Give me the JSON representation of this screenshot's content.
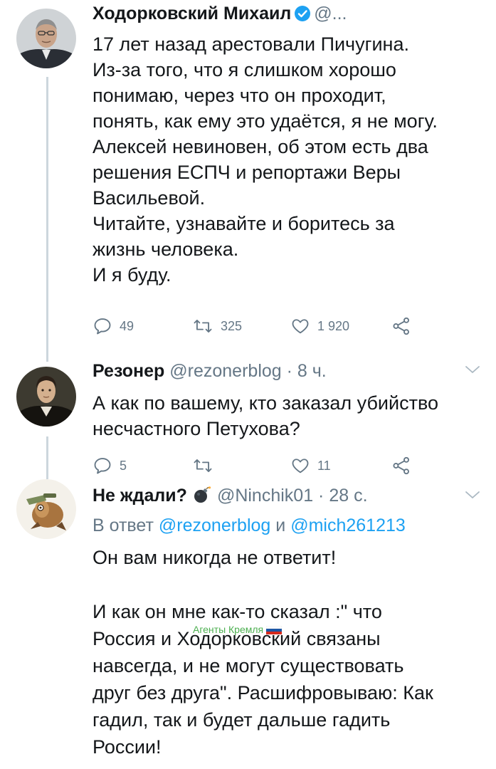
{
  "tweet1": {
    "name": "Ходорковский Михаил",
    "handle": "@...",
    "lines": [
      "17 лет назад арестовали Пичугина.",
      "Из-за того, что я слишком хорошо",
      "понимаю, через что он проходит,",
      "понять, как ему это удаётся, я не могу.",
      "Алексей невиновен, об этом есть два",
      "решения ЕСПЧ и репортажи Веры",
      "Васильевой.",
      "Читайте, узнавайте и боритесь за",
      "жизнь человека.",
      "И я буду."
    ],
    "replies": "49",
    "retweets": "325",
    "likes": "1 920"
  },
  "tweet2": {
    "name": "Резонер",
    "handle": "@rezonerblog",
    "time": "· 8 ч.",
    "lines": [
      "А как по вашему, кто заказал убийство",
      "несчастного Петухова?"
    ],
    "replies": "5",
    "retweets": "",
    "likes": "11"
  },
  "tweet3": {
    "name": "Не ждали?",
    "handle": "@Ninchik01",
    "time": "· 28 с.",
    "reply_prefix": "В ответ",
    "reply_mention1": "@rezonerblog",
    "reply_and": "и",
    "reply_mention2": "@mich261213",
    "lines": [
      "Он вам никогда не ответит!",
      "",
      "И как он мне как-то сказал :\" что",
      "Россия и Ходорковский связаны",
      "навсегда, и не могут существовать",
      "друг без друга\". Расшифровываю: Как",
      "гадил, так и будет дальше гадить",
      "России!"
    ]
  },
  "watermark": "Агенты Кремля",
  "colors": {
    "text": "#14171a",
    "secondary": "#657786",
    "link": "#1da1f2",
    "verified": "#1da1f2",
    "thread_line": "#ccd6dd",
    "watermark": "#4caf50"
  },
  "icons": [
    "verified-badge-icon",
    "reply-icon",
    "retweet-icon",
    "like-icon",
    "share-icon",
    "chevron-down-icon",
    "bomb-icon"
  ]
}
